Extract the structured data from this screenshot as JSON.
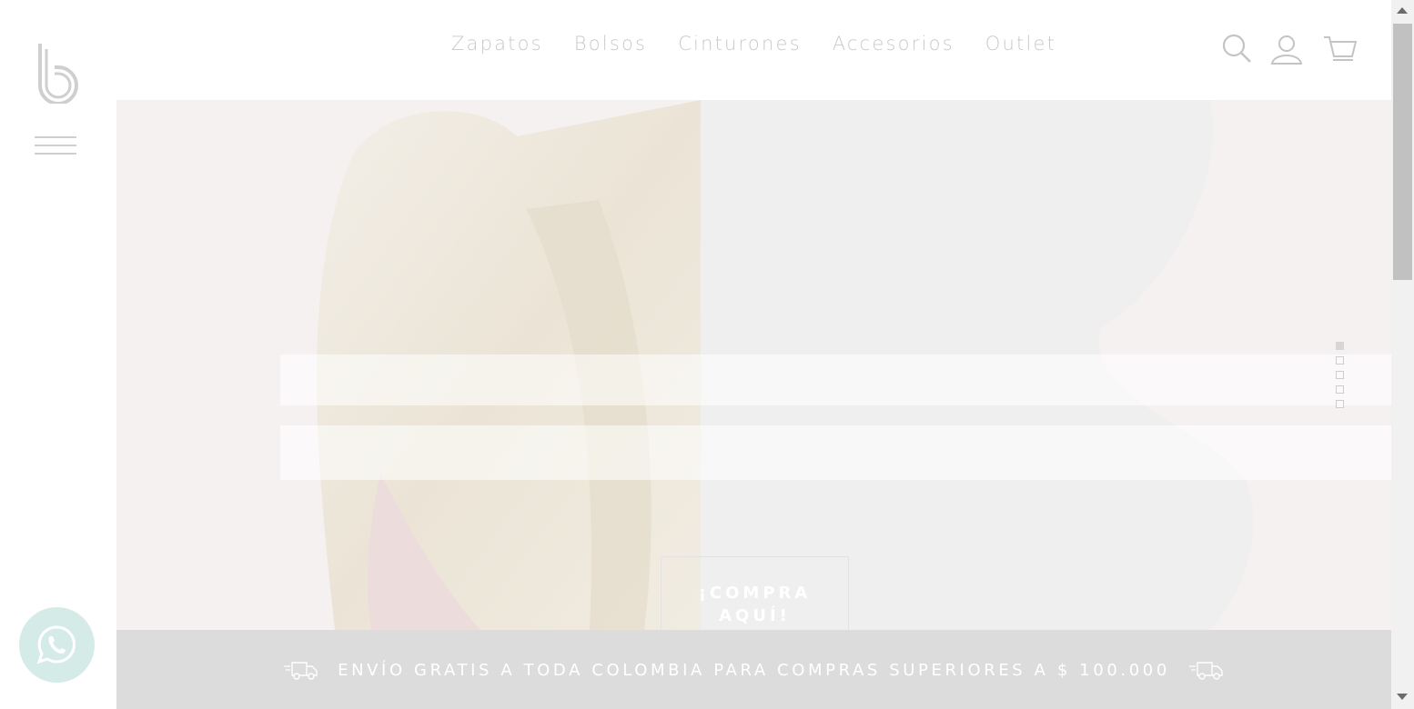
{
  "header": {
    "nav": [
      {
        "label": "Zapatos"
      },
      {
        "label": "Bolsos"
      },
      {
        "label": "Cinturones"
      },
      {
        "label": "Accesorios"
      },
      {
        "label": "Outlet"
      }
    ],
    "icons": [
      "search-icon",
      "user-icon",
      "cart-icon"
    ]
  },
  "hero": {
    "cta_line1": "¡COMPRA",
    "cta_line2": "AQUÍ!",
    "slides": 5,
    "active_slide": 1
  },
  "shipping": {
    "text": "ENVÍO GRATIS A TODA COLOMBIA PARA COMPRAS SUPERIORES A $ 100.000"
  },
  "colors": {
    "nav_text": "#c9c9c9",
    "shipping_bar": "#dcdcdc",
    "whatsapp_bg": "#d5ebe8"
  }
}
